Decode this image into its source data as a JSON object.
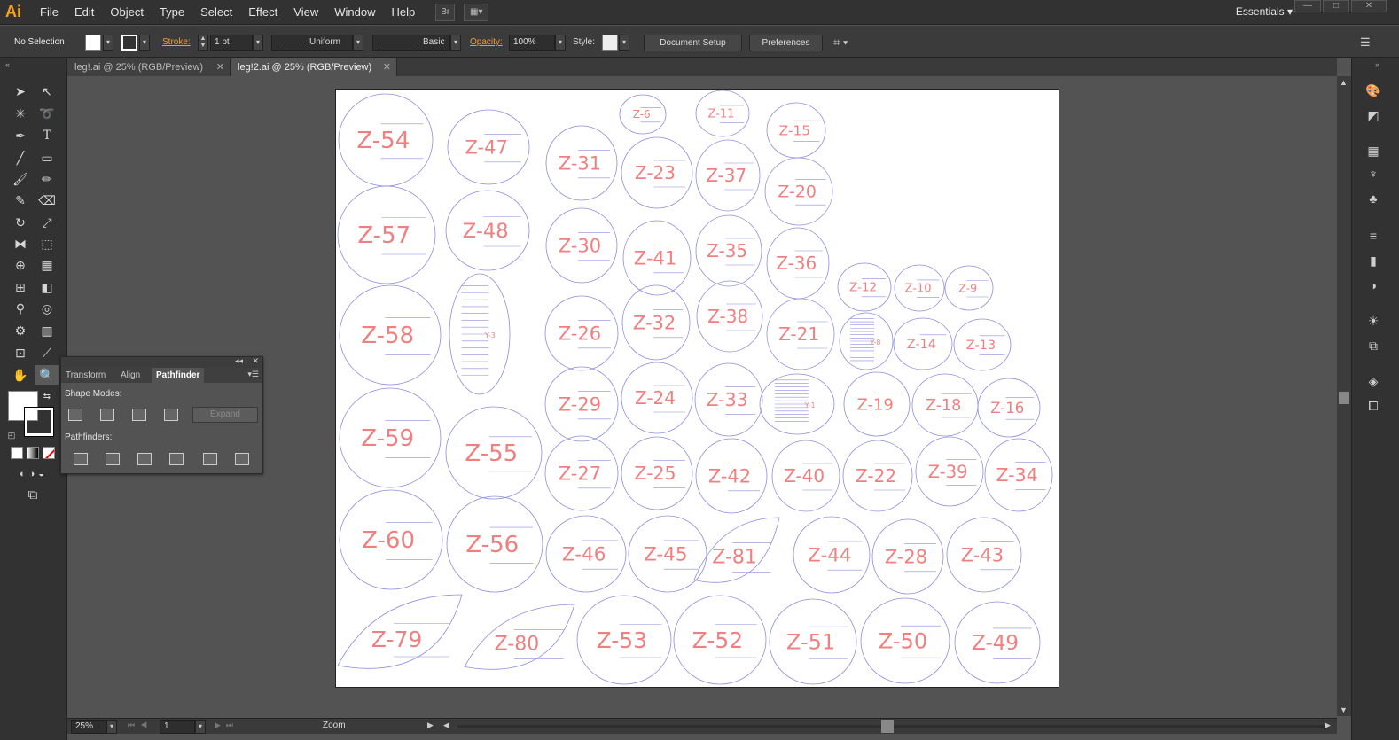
{
  "app": {
    "logo": "Ai"
  },
  "menu": [
    "File",
    "Edit",
    "Object",
    "Type",
    "Select",
    "Effect",
    "View",
    "Window",
    "Help"
  ],
  "menu_icons": {
    "bridge": "Br",
    "arrange": "▦▾"
  },
  "workspace": {
    "label": "Essentials",
    "arrow": "▾"
  },
  "window_controls": [
    "—",
    "□",
    "✕"
  ],
  "control_bar": {
    "selection": "No Selection",
    "stroke_label": "Stroke:",
    "stroke_weight": "1 pt",
    "profile": "Uniform",
    "brush": "Basic",
    "opacity_label": "Opacity:",
    "opacity_value": "100%",
    "style_label": "Style:",
    "document_setup": "Document Setup",
    "preferences": "Preferences"
  },
  "tabs": [
    {
      "label": "leg!.ai @ 25% (RGB/Preview)",
      "close": "✕",
      "active": false
    },
    {
      "label": "leg!2.ai @ 25% (RGB/Preview)",
      "close": "✕",
      "active": true
    }
  ],
  "panel": {
    "tabs": [
      "Transform",
      "Align",
      "Pathfinder"
    ],
    "active_tab": "Pathfinder",
    "shape_modes_label": "Shape Modes:",
    "expand_label": "Expand",
    "pathfinders_label": "Pathfinders:"
  },
  "status": {
    "zoom": "25%",
    "page": "1",
    "tool_name": "Zoom"
  },
  "colors": {
    "shape_stroke": "#8c8ce0",
    "label_color": "#f08080",
    "accent": "#f29a38"
  },
  "artwork_labels": [
    "Z-54",
    "Z-47",
    "Z-6",
    "Z-11",
    "Z-15",
    "Z-31",
    "Z-23",
    "Z-37",
    "Z-20",
    "Z-57",
    "Z-48",
    "Z-30",
    "Z-41",
    "Z-35",
    "Z-36",
    "Z-12",
    "Z-10",
    "Z-9",
    "Z-58",
    "Z-26",
    "Z-32",
    "Z-38",
    "Z-21",
    "Z-14",
    "Z-13",
    "Z-29",
    "Z-24",
    "Z-33",
    "Z-19",
    "Z-18",
    "Z-16",
    "Z-59",
    "Z-55",
    "Z-27",
    "Z-25",
    "Z-42",
    "Z-40",
    "Z-22",
    "Z-39",
    "Z-34",
    "Z-60",
    "Z-56",
    "Z-46",
    "Z-45",
    "Z-81",
    "Z-44",
    "Z-28",
    "Z-43",
    "Z-79",
    "Z-80",
    "Z-53",
    "Z-52",
    "Z-51",
    "Z-50",
    "Z-49",
    "Y-3",
    "Y-8",
    "Y-1"
  ]
}
